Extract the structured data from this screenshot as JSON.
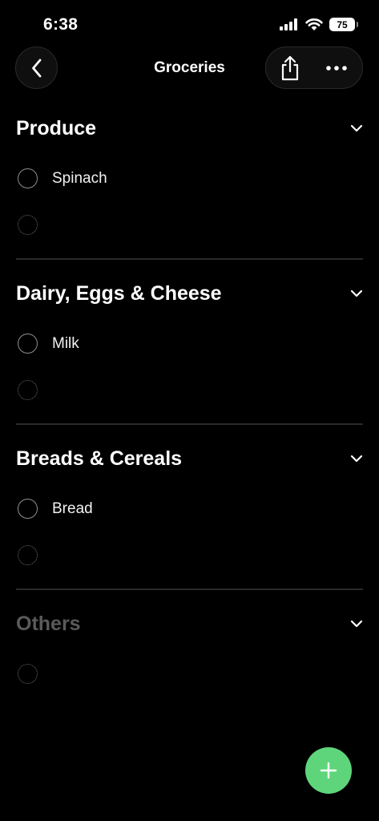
{
  "status_bar": {
    "time": "6:38",
    "battery": "75"
  },
  "nav": {
    "title": "Groceries",
    "icons": [
      "chevron-left-icon",
      "share-icon",
      "more-icon"
    ]
  },
  "sections": [
    {
      "title": "Produce",
      "items": [
        {
          "label": "Spinach"
        }
      ]
    },
    {
      "title": "Dairy, Eggs & Cheese",
      "items": [
        {
          "label": "Milk"
        }
      ]
    },
    {
      "title": "Breads & Cereals",
      "items": [
        {
          "label": "Bread"
        }
      ]
    },
    {
      "title": "Others",
      "items": []
    }
  ],
  "colors": {
    "accent": "#5fd57b",
    "background": "#000000",
    "muted_title": "#5a5a5a"
  }
}
